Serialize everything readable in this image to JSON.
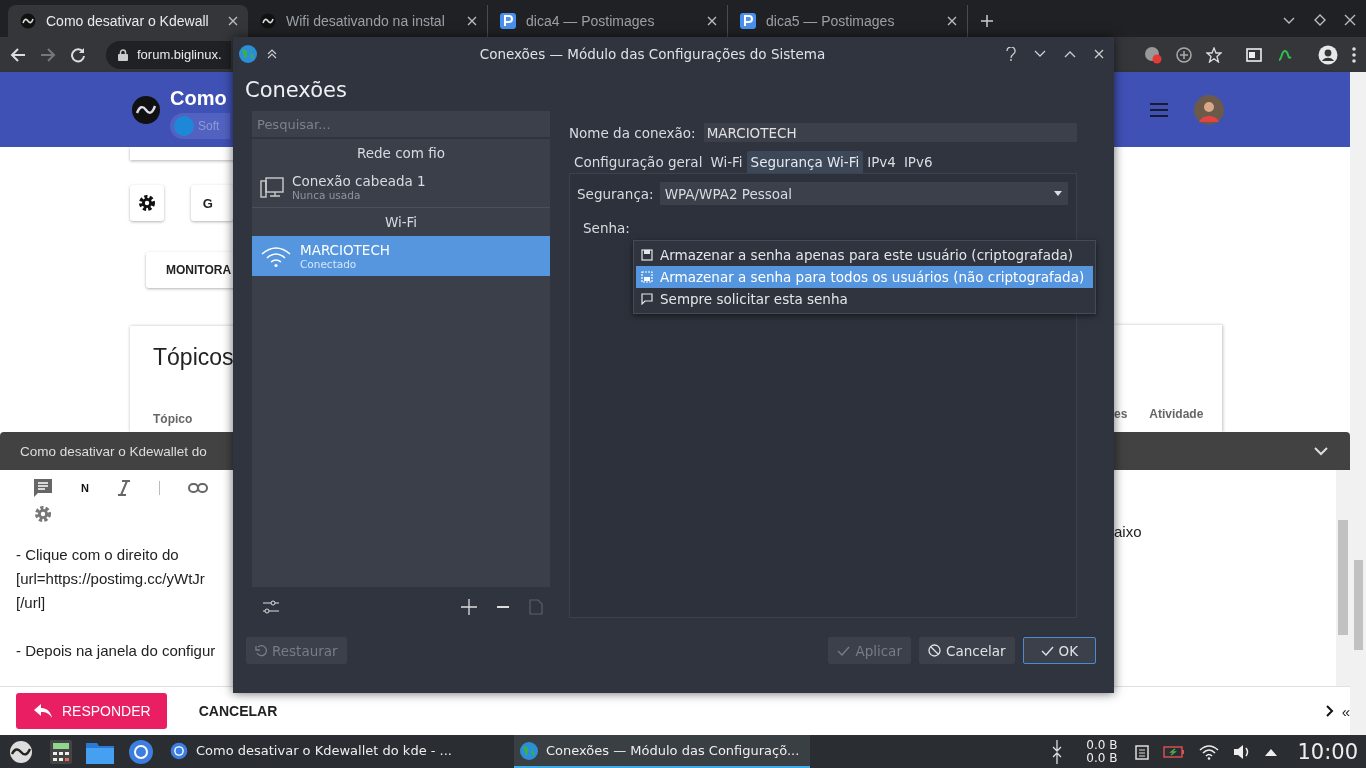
{
  "browser": {
    "tabs": [
      {
        "title": "Como desativar o Kdewall",
        "selected": true
      },
      {
        "title": "Wifi desativando na instal",
        "selected": false
      },
      {
        "title": "dica4 — Postimages",
        "selected": false
      },
      {
        "title": "dica5 — Postimages",
        "selected": false
      }
    ],
    "address": "forum.biglinux."
  },
  "forum": {
    "title": "Como",
    "category": "Soft",
    "g_button": "G",
    "monitor_button": "MONITORA",
    "topics_heading": "Tópicos",
    "columns_left": [
      "Tópico"
    ],
    "columns_right": [
      "es",
      "Atividade"
    ]
  },
  "composer": {
    "title": "Como desativar o Kdewallet do",
    "bold_button": "N",
    "paragraphs_left": [
      [
        "- Clique com o direito do",
        "[url=https://postimg.cc/yWtJr",
        "[/url]"
      ],
      [
        "- Depois na janela do configur"
      ]
    ],
    "line_right": "aixo",
    "reply_button": "RESPONDER",
    "cancel_button": "CANCELAR",
    "pager": "«"
  },
  "dialog": {
    "title": "Conexões — Módulo das Configurações do Sistema",
    "heading": "Conexões",
    "search": {
      "placeholder": "Pesquisar..."
    },
    "connection_groups": [
      {
        "label": "Rede com fio",
        "items": [
          {
            "name": "Conexão cabeada 1",
            "status": "Nunca usada",
            "kind": "wired",
            "selected": false
          }
        ]
      },
      {
        "label": "Wi-Fi",
        "items": [
          {
            "name": "MARCIOTECH",
            "status": "Conectado",
            "kind": "wifi",
            "selected": true
          }
        ]
      }
    ],
    "connection_name_label": "Nome da conexão:",
    "connection_name": "MARCIOTECH",
    "tabs": [
      {
        "label": "Configuração geral",
        "selected": false
      },
      {
        "label": "Wi-Fi",
        "selected": false
      },
      {
        "label": "Segurança Wi-Fi",
        "selected": true
      },
      {
        "label": "IPv4",
        "selected": false
      },
      {
        "label": "IPv6",
        "selected": false
      }
    ],
    "security_label": "Segurança:",
    "security_value": "WPA/WPA2 Pessoal",
    "password_label": "Senha:",
    "password_menu": [
      {
        "label": "Armazenar a senha apenas para este usuário (criptografada)",
        "kind": "user",
        "selected": false
      },
      {
        "label": "Armazenar a senha para todos os usuários (não criptografada)",
        "kind": "all",
        "selected": true
      },
      {
        "label": "Sempre solicitar esta senha",
        "kind": "ask",
        "selected": false
      }
    ],
    "buttons": [
      {
        "label": "Restaurar",
        "kind": "reset",
        "disabled": true,
        "default": false
      },
      {
        "label": "Aplicar",
        "kind": "apply",
        "disabled": true,
        "default": false
      },
      {
        "label": "Cancelar",
        "kind": "cancel",
        "disabled": false,
        "default": false
      },
      {
        "label": "OK",
        "kind": "ok",
        "disabled": false,
        "default": true
      }
    ]
  },
  "taskbar": {
    "tasks": [
      {
        "title": "Como desativar o Kdewallet do kde - ...",
        "kind": "browser",
        "selected": false
      },
      {
        "title": "Conexões — Módulo das Configuraçõ...",
        "kind": "settings",
        "selected": true
      }
    ],
    "net_up": "0.0 B",
    "net_down": "0.0 B",
    "clock": "10:00"
  }
}
